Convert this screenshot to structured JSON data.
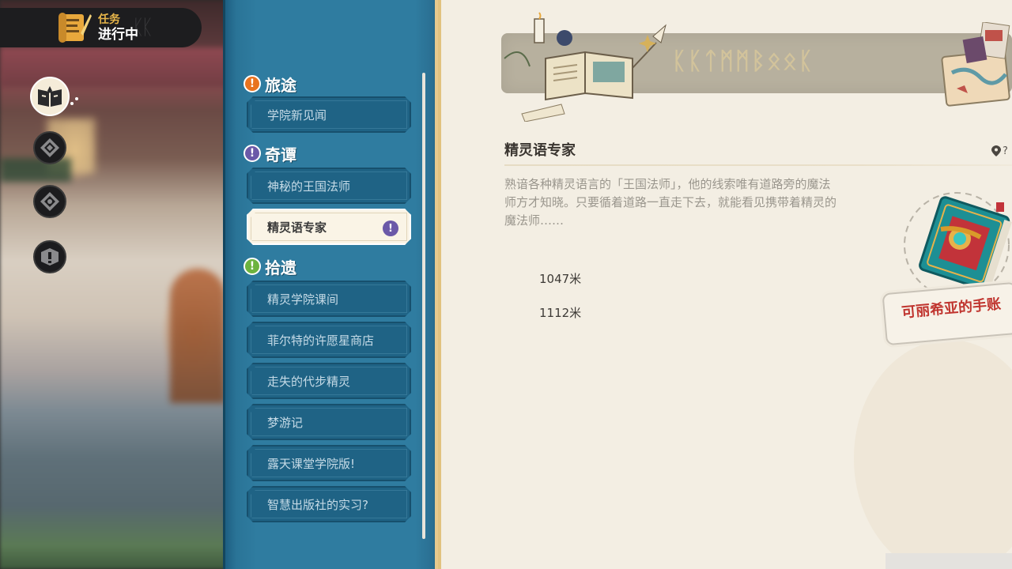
{
  "header": {
    "subtitle": "任务",
    "title": "进行中"
  },
  "nav": {
    "items": [
      {
        "name": "quest-book-icon",
        "active": true
      },
      {
        "name": "diamond-icon-1",
        "active": false
      },
      {
        "name": "diamond-icon-2",
        "active": false
      },
      {
        "name": "exclamation-icon",
        "active": false
      }
    ]
  },
  "sections": [
    {
      "label": "旅途",
      "icon": "!",
      "color": "#e8731f",
      "quests": [
        "学院新见闻"
      ]
    },
    {
      "label": "奇谭",
      "icon": "!",
      "color": "#6b59a8",
      "quests": [
        "神秘的王国法师",
        "精灵语专家"
      ]
    },
    {
      "label": "拾遗",
      "icon": "!",
      "color": "#6db33f",
      "quests": [
        "精灵学院课间",
        "菲尔特的许愿星商店",
        "走失的代步精灵",
        "梦游记",
        "露天课堂学院版!",
        "智慧出版社的实习?"
      ]
    }
  ],
  "selected_quest": {
    "badge": "!",
    "title": "精灵语专家",
    "description": "熟谙各种精灵语言的「王国法师」，他的线索唯有道路旁的魔法师方才知晓。只要循着道路一直走下去，就能看见携带着精灵的魔法师……",
    "distances": [
      "1047米",
      "1112米"
    ],
    "map_pin_suffix": "?"
  },
  "book_label": "可丽希亚的手账",
  "colors": {
    "panel_blue": "#2f7ca0",
    "parchment": "#f3eee3",
    "accent_gold": "#e8b64a"
  }
}
